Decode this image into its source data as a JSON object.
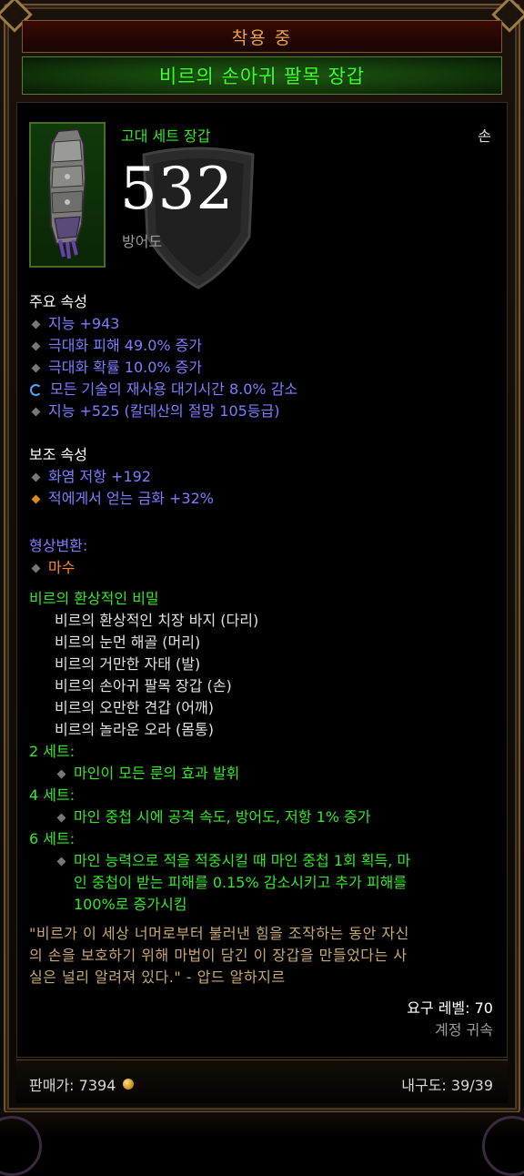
{
  "header": {
    "equipped_label": "착용 중",
    "item_name": "비르의 손아귀 팔목 장갑"
  },
  "item": {
    "type": "고대 세트 장갑",
    "slot": "손",
    "armor_value": "532",
    "armor_label": "방어도",
    "icon": "gauntlet-icon"
  },
  "primary": {
    "title": "주요 속성",
    "stats": [
      "지능 +943",
      "극대화 피해 49.0% 증가",
      "극대화 확률 10.0% 증가",
      "모든 기술의 재사용 대기시간 8.0% 감소",
      "지능 +525 (칼데산의 절망 105등급)"
    ]
  },
  "secondary": {
    "title": "보조 속성",
    "stats": [
      "화염 저항 +192",
      "적에게서 얻는 금화 +32%"
    ]
  },
  "transmog": {
    "title": "형상변환:",
    "value": "마수"
  },
  "set": {
    "name": "비르의 환상적인 비밀",
    "pieces": [
      "비르의 환상적인 치장 바지 (다리)",
      "비르의 눈먼 해골 (머리)",
      "비르의 거만한 자태 (발)",
      "비르의 손아귀 팔목 장갑 (손)",
      "비르의 오만한 견갑 (어깨)",
      "비르의 놀라운 오라 (몸통)"
    ],
    "bonuses": [
      {
        "label": "2 세트:",
        "lines": [
          "마인이 모든 룬의 효과 발휘"
        ]
      },
      {
        "label": "4 세트:",
        "lines": [
          "마인 중첩 시에 공격 속도, 방어도, 저항 1% 증가"
        ]
      },
      {
        "label": "6 세트:",
        "lines": [
          "마인 능력으로 적을 적중시킬 때 마인 중첩 1회 획득, 마",
          "인 중첩이 받는 피해를 0.15% 감소시키고 추가 피해를",
          "100%로 증가시킴"
        ]
      }
    ]
  },
  "flavor": [
    "\"비르가 이 세상 너머로부터 불러낸 힘을 조작하는 동안 자신",
    "의 손을 보호하기 위해 마법이 담긴 이 장갑을 만들었다는 사",
    "실은 널리 알려져 있다.\" - 압드 알하지르"
  ],
  "requirements": {
    "level": "요구 레벨: 70",
    "bound": "계정 귀속"
  },
  "footer": {
    "price_label": "판매가: 7394",
    "durability": "내구도: 39/39"
  },
  "colors": {
    "set_green": "#33e82a",
    "magic_blue": "#7d7dff",
    "legendary_orange": "#ff8a1e",
    "flavor_gold": "#c8a773"
  }
}
